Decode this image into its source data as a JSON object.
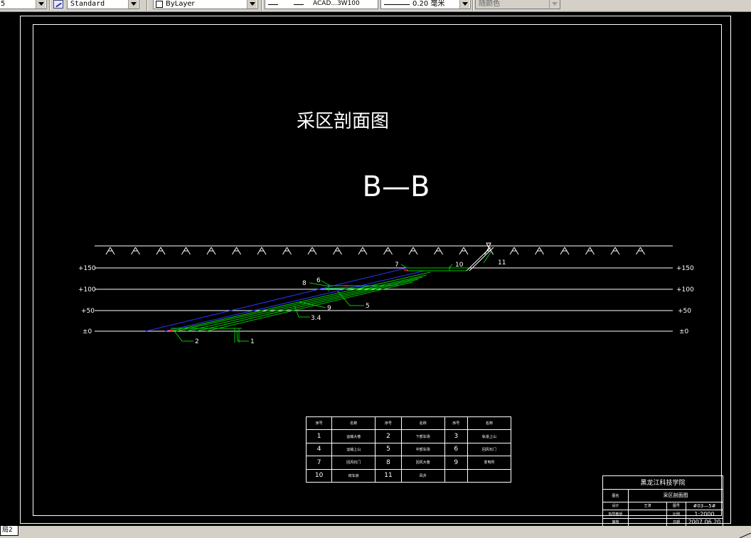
{
  "toolbar": {
    "combo1_value": "5",
    "text_style": "Standard",
    "layer": "ByLayer",
    "linetype": "ACAD...3W100",
    "lineweight": "0.20 毫米",
    "plot_style": "随颜色"
  },
  "drawing": {
    "title": "采区剖面图",
    "section_label": "B—B",
    "elevations_left": [
      "+150",
      "+100",
      "+50",
      "±0"
    ],
    "elevations_right": [
      "+150",
      "+100",
      "+50",
      "±0"
    ],
    "callouts": [
      "7",
      "10",
      "11",
      "8",
      "6",
      "5",
      "9",
      "3.4",
      "2",
      "1"
    ],
    "colors": {
      "background": "#000000",
      "blue_line": "#3030ff",
      "green_line": "#00c800",
      "red_mark": "#ff2020"
    }
  },
  "legend": {
    "rows": [
      [
        "序号",
        "名称",
        "序号",
        "名称",
        "序号",
        "名称"
      ],
      [
        "1",
        "运输大巷",
        "2",
        "下部车场",
        "3",
        "轨道上山"
      ],
      [
        "4",
        "运输上山",
        "5",
        "中部车场",
        "6",
        "回风石门"
      ],
      [
        "7",
        "回风石门",
        "8",
        "回风大巷",
        "9",
        "变电所"
      ],
      [
        "10",
        "绞车房",
        "11",
        "风井",
        "",
        ""
      ]
    ]
  },
  "titleblock": {
    "school": "黑龙江科技学院",
    "label_drawing_name": "图名",
    "drawing_name": "采区剖面图",
    "label_designer": "设计",
    "designer": "王涛",
    "label_drawing_no": "图号",
    "drawing_no": "#03—5#",
    "label_advisor": "指导教师",
    "advisor": "",
    "label_scale": "比例",
    "scale": "1:2000",
    "label_review": "审核",
    "reviewer": "",
    "label_date": "日期",
    "date": "2007.06.20"
  },
  "tabs": {
    "layout2": "局2"
  }
}
